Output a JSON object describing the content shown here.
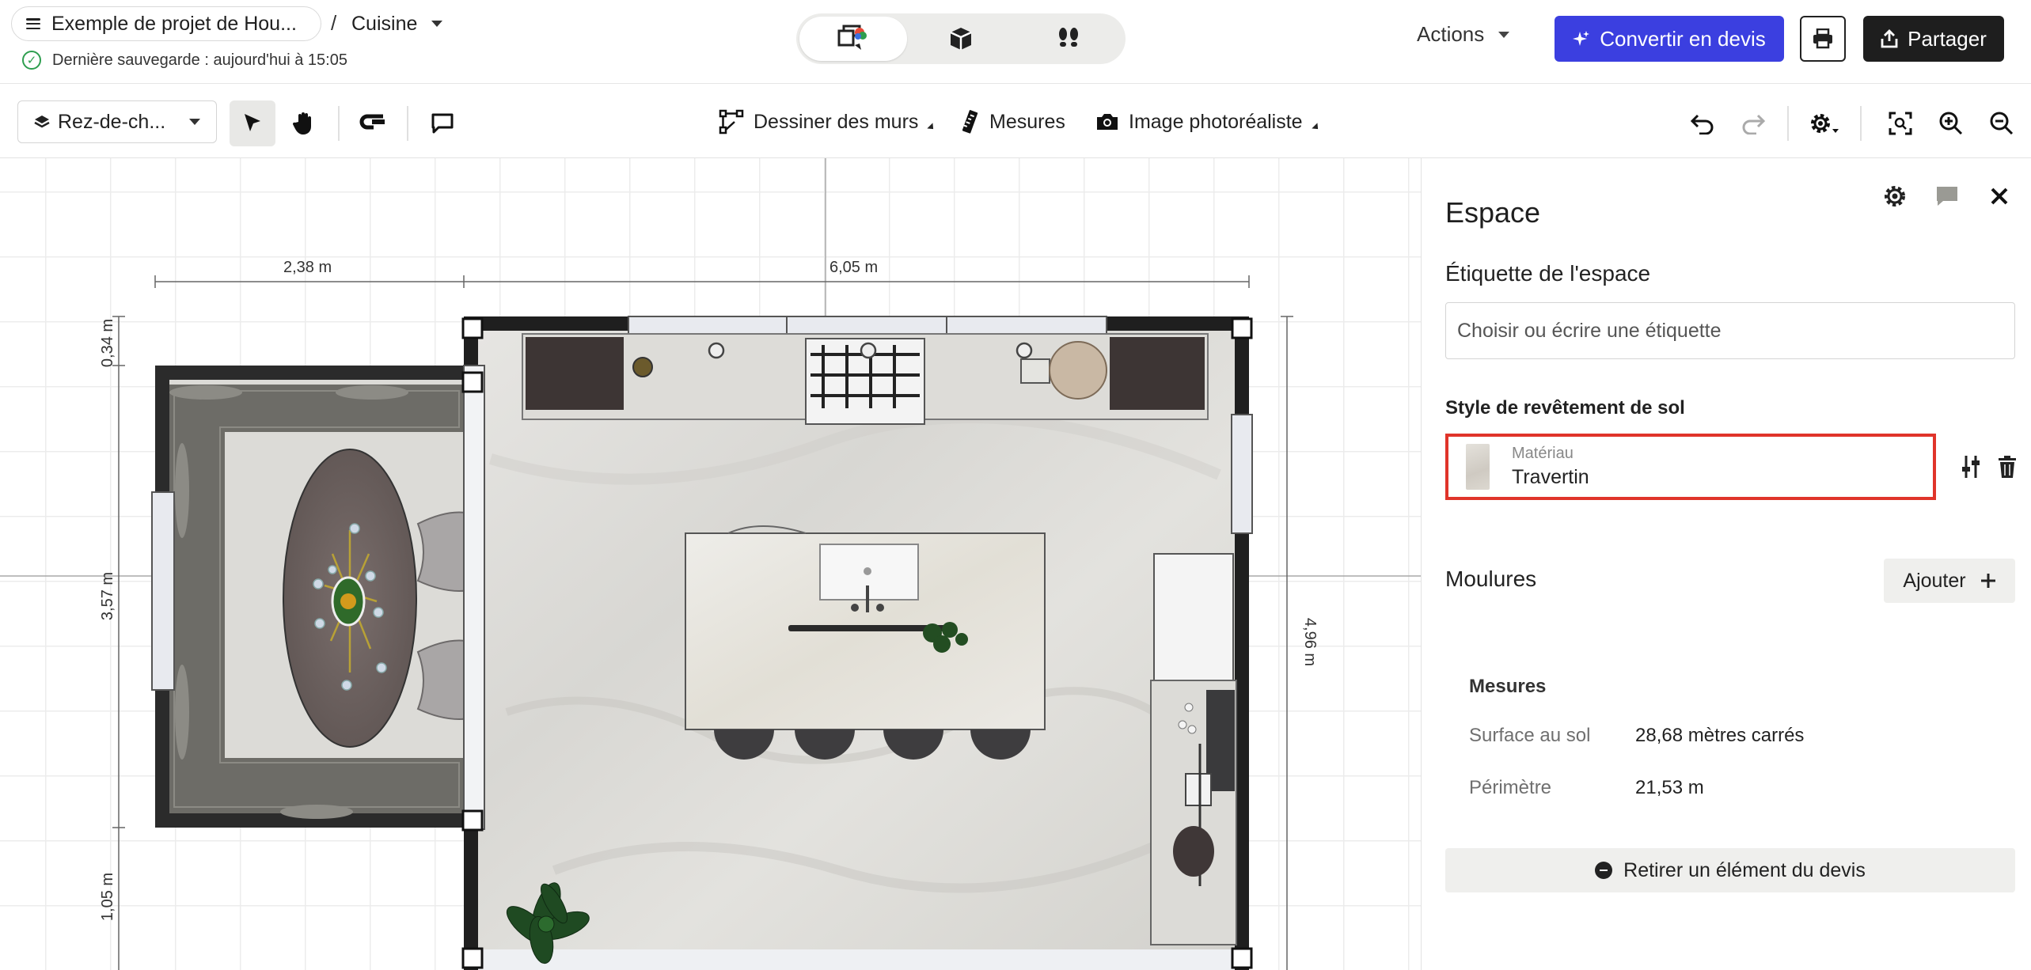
{
  "header": {
    "project_name": "Exemple de projet de Hou...",
    "separator": "/",
    "room_name": "Cuisine",
    "save_status": "Dernière sauvegarde : aujourd'hui à 15:05",
    "actions_label": "Actions",
    "convert_label": "Convertir en devis",
    "share_label": "Partager",
    "accent_color": "#3b3fe0"
  },
  "view_modes": [
    "plan-2d-icon",
    "box-3d-icon",
    "walkthrough-footsteps-icon"
  ],
  "toolbar": {
    "floor_label": "Rez-de-ch...",
    "draw_walls_label": "Dessiner des murs",
    "measures_label": "Mesures",
    "photo_label": "Image photoréaliste"
  },
  "plan": {
    "dimensions": {
      "top_left": "2,38 m",
      "top_main": "6,05 m",
      "left_top": "0,34 m",
      "left_mid": "3,57 m",
      "left_bottom": "1,05 m",
      "right": "4,96 m"
    }
  },
  "panel": {
    "title": "Espace",
    "space_label_heading": "Étiquette de l'espace",
    "space_label_placeholder": "Choisir ou écrire une étiquette",
    "floor_style_heading": "Style de revêtement de sol",
    "material_caption": "Matériau",
    "material_value": "Travertin",
    "moldings_heading": "Moulures",
    "add_label": "Ajouter",
    "measures_heading": "Mesures",
    "floor_area_label": "Surface au sol",
    "floor_area_value": "28,68 mètres carrés",
    "perimeter_label": "Périmètre",
    "perimeter_value": "21,53 m",
    "remove_label": "Retirer un élément du devis",
    "highlight_color": "#e0342a"
  }
}
